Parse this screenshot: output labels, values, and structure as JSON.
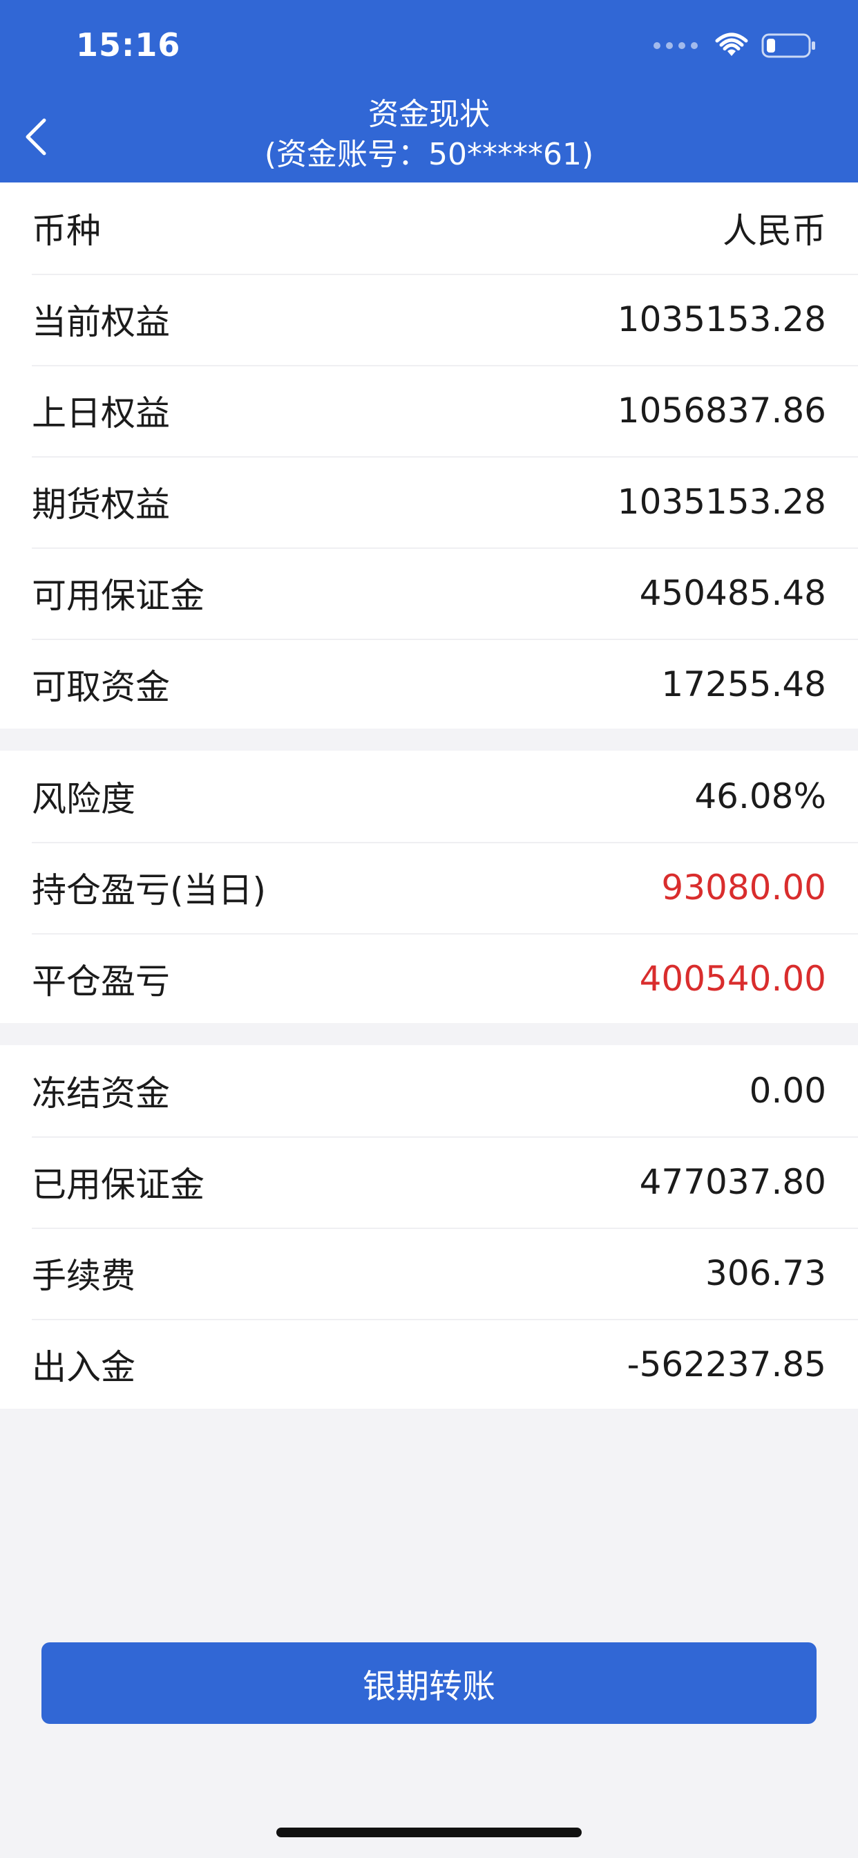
{
  "status_bar": {
    "time": "15:16"
  },
  "header": {
    "title": "资金现状",
    "subtitle": "(资金账号：50*****61)"
  },
  "icons": {
    "back": "chevron-left-icon",
    "wifi": "wifi-icon",
    "battery": "battery-icon",
    "signal": "signal-icon"
  },
  "sections": [
    {
      "rows": [
        {
          "label": "币种",
          "value": "人民币"
        },
        {
          "label": "当前权益",
          "value": "1035153.28"
        },
        {
          "label": "上日权益",
          "value": "1056837.86"
        },
        {
          "label": "期货权益",
          "value": "1035153.28"
        },
        {
          "label": "可用保证金",
          "value": "450485.48"
        },
        {
          "label": "可取资金",
          "value": "17255.48"
        }
      ]
    },
    {
      "rows": [
        {
          "label": "风险度",
          "value": "46.08%"
        },
        {
          "label": "持仓盈亏(当日)",
          "value": "93080.00"
        },
        {
          "label": "平仓盈亏",
          "value": "400540.00"
        }
      ]
    },
    {
      "rows": [
        {
          "label": "冻结资金",
          "value": "0.00"
        },
        {
          "label": "已用保证金",
          "value": "477037.80"
        },
        {
          "label": "手续费",
          "value": "306.73"
        },
        {
          "label": "出入金",
          "value": "-562237.85"
        }
      ]
    }
  ],
  "transfer_button_label": "银期转账",
  "colors": {
    "brand": "#3167d5",
    "profit_red": "#d92d2d",
    "background": "#f3f3f6"
  }
}
